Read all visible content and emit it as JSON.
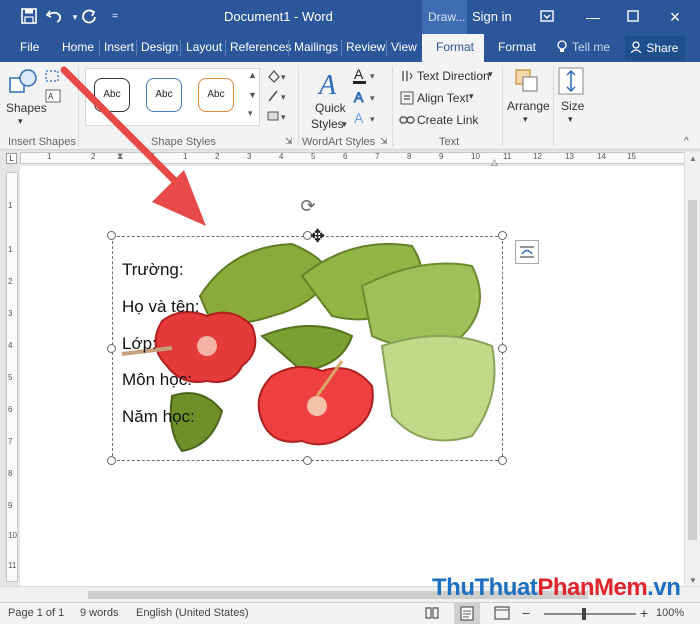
{
  "title_bar": {
    "document_title": "Document1 - Word",
    "context_tab_label": "Draw...",
    "sign_in": "Sign in",
    "quick_access": [
      "save-icon",
      "undo-icon",
      "redo-icon",
      "customize-icon"
    ],
    "window_controls": [
      "ribbon-display-icon",
      "minimize-icon",
      "maximize-icon",
      "close-icon"
    ]
  },
  "tabs": {
    "items": [
      "File",
      "Home",
      "Insert",
      "Design",
      "Layout",
      "References",
      "Mailings",
      "Review",
      "View",
      "Format",
      "Format"
    ],
    "tell_me": "Tell me",
    "share": "Share"
  },
  "ribbon": {
    "insert_shapes": {
      "label": "Insert Shapes",
      "shapes_button": "Shapes"
    },
    "shape_styles": {
      "label": "Shape Styles",
      "presets": [
        "Abc",
        "Abc",
        "Abc"
      ]
    },
    "wordart": {
      "label": "WordArt Styles",
      "quick_styles_line1": "Quick",
      "quick_styles_line2": "Styles"
    },
    "text": {
      "label": "Text",
      "text_direction": "Text Direction",
      "align_text": "Align Text",
      "create_link": "Create Link"
    },
    "arrange": "Arrange",
    "size": "Size"
  },
  "ruler": {
    "top_numbers": [
      "1",
      "2",
      "1",
      "1",
      "2",
      "3",
      "4",
      "5",
      "6",
      "7",
      "8",
      "9",
      "10",
      "11",
      "12",
      "13",
      "14",
      "15"
    ],
    "left_numbers": [
      "1",
      "1",
      "2",
      "3",
      "4",
      "5",
      "6",
      "7",
      "8",
      "9",
      "10",
      "11"
    ]
  },
  "document": {
    "lines": [
      "Trường:",
      "Họ và tên:",
      "Lớp:",
      "Môn học:",
      "Năm học:"
    ]
  },
  "status_bar": {
    "page": "Page 1 of 1",
    "words": "9 words",
    "language": "English (United States)",
    "zoom": "100%"
  },
  "watermark": {
    "part1": "ThuThuat",
    "part2": "PhanMem",
    "part3": ".vn"
  },
  "colors": {
    "word_blue": "#2b579a",
    "arrow_red": "#e84a4a",
    "hibiscus_red": "#e53a3a",
    "leaf_green": "#7ea33a"
  }
}
